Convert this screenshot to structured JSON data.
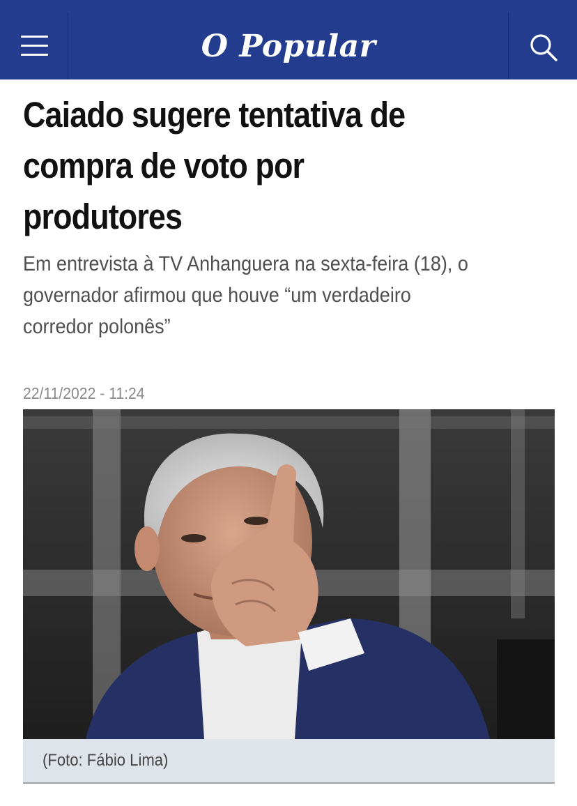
{
  "header": {
    "logo_text": "O Popular",
    "menu_icon": "hamburger-menu-icon",
    "search_icon": "search-icon",
    "background_color": "#233c8e"
  },
  "article": {
    "headline_lines": [
      "Caiado sugere tentativa de",
      "compra de voto por",
      "produtores"
    ],
    "subtitle_lines": [
      "Em entrevista à TV Anhanguera na sexta-feira (18), o",
      "governador afirmou que houve “um verdadeiro",
      "corredor polonês”"
    ],
    "date": "22/11/2022 - 11:24",
    "photo_caption": "(Foto: Fábio Lima)"
  }
}
